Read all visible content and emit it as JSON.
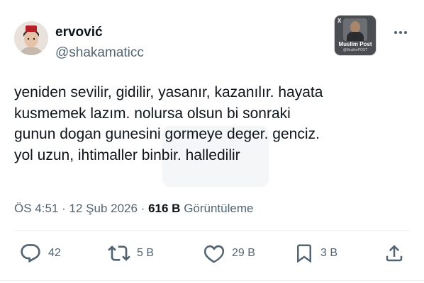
{
  "author": {
    "name": "ervović",
    "handle": "@shakamaticc"
  },
  "badge": {
    "title": "Muslim Post",
    "subtitle": "@MuslimPOST",
    "x_mark": "X"
  },
  "tweet": {
    "text": "yeniden sevilir, gidilir, yasanır, kazanılır. hayata\nkusmemek lazım. nolursa olsun bi sonraki\ngunun dogan gunesini gormeye deger. genciz.\nyol uzun, ihtimaller binbir. halledilir"
  },
  "meta": {
    "time": "ÖS 4:51",
    "sep1": "·",
    "date": "12 Şub 2026",
    "sep2": "·",
    "views_count": "616 B",
    "views_label": "Görüntüleme"
  },
  "actions": {
    "replies": "42",
    "reposts": "5 B",
    "likes": "29 B",
    "bookmarks": "3 B"
  },
  "icons": {
    "avatar": "avatar-image",
    "more": "more-icon",
    "reply": "reply-icon",
    "repost": "repost-icon",
    "like": "heart-icon",
    "bookmark": "bookmark-icon",
    "share": "share-icon"
  },
  "colors": {
    "text": "#0f1419",
    "secondary": "#536471",
    "divider": "#eff3f4"
  }
}
